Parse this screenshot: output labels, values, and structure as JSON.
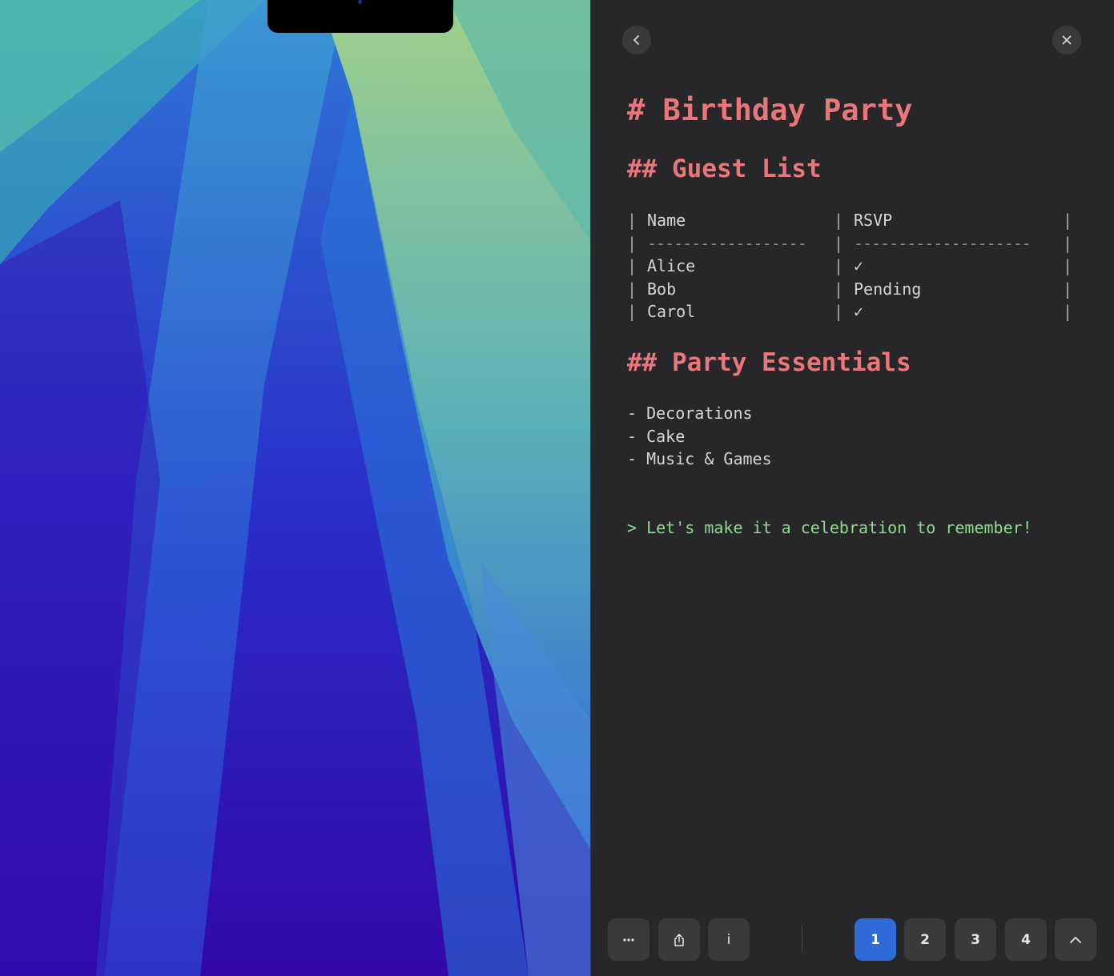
{
  "document": {
    "title": "# Birthday Party",
    "guest_heading": "## Guest List",
    "table": {
      "headers": [
        "Name",
        "RSVP"
      ],
      "rows": [
        [
          "Alice",
          "✓"
        ],
        [
          "Bob",
          "Pending"
        ],
        [
          "Carol",
          "✓"
        ]
      ]
    },
    "essentials_heading": "## Party Essentials",
    "essentials": [
      "- Decorations",
      "- Cake",
      "- Music & Games"
    ],
    "quote": "> Let's make it a celebration to remember!"
  },
  "toolbar": {
    "pages": [
      "1",
      "2",
      "3",
      "4"
    ],
    "info_label": "i",
    "active_page": "1"
  },
  "icons": {
    "back": "chevron-left-icon",
    "close": "close-icon",
    "more": "ellipsis-icon",
    "share": "share-icon",
    "collapse": "chevron-up-icon"
  },
  "colors": {
    "heading": "#e8767a",
    "quote": "#8fdc8f",
    "active_page": "#2f6bd8",
    "panel_bg": "#272729"
  }
}
